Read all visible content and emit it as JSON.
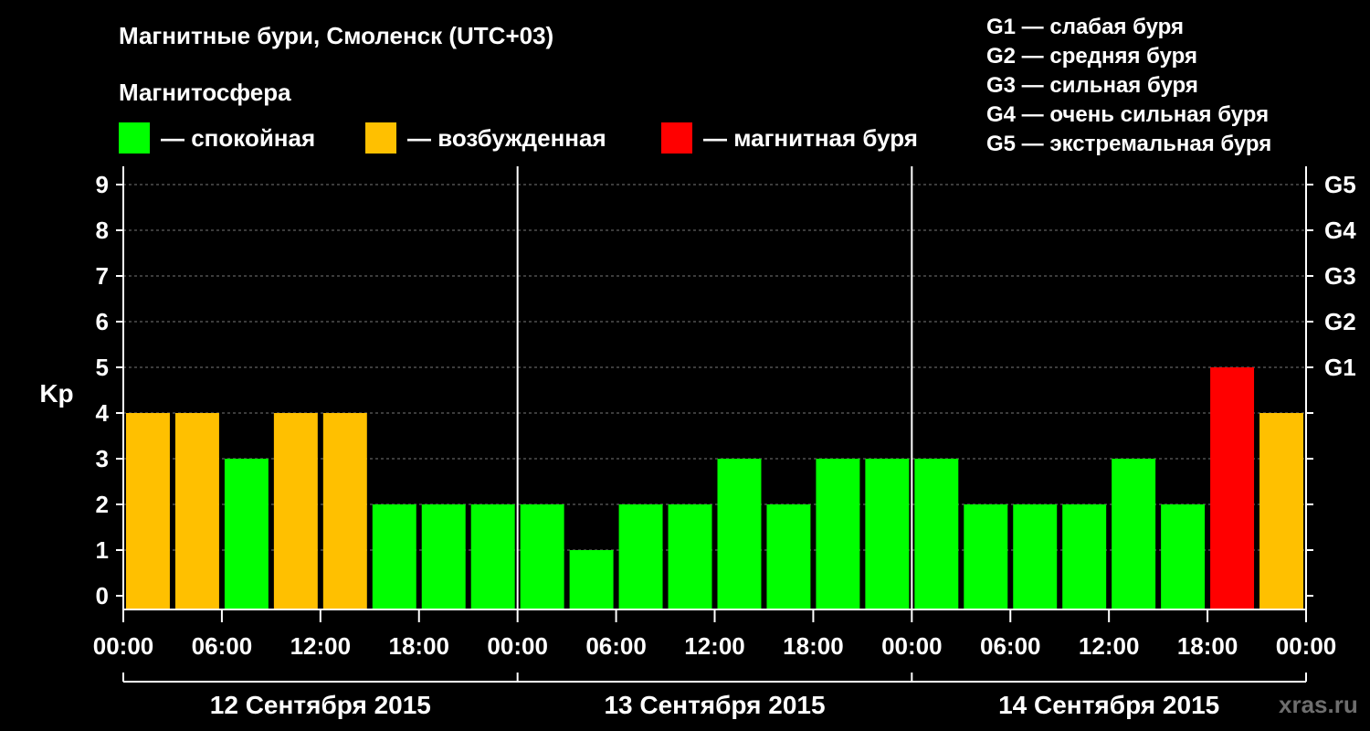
{
  "header": {
    "title": "Магнитные бури, Смоленск (UTC+03)",
    "subtitle": "Магнитосфера"
  },
  "legend": [
    {
      "color": "#00ff00",
      "label": "— спокойная"
    },
    {
      "color": "#ffc000",
      "label": "— возбужденная"
    },
    {
      "color": "#ff0000",
      "label": "— магнитная буря"
    }
  ],
  "g_legend": [
    "G1 — слабая буря",
    "G2 — средняя буря",
    "G3 — сильная буря",
    "G4 — очень сильная буря",
    "G5 — экстремальная буря"
  ],
  "watermark": "xras.ru",
  "chart_data": {
    "type": "bar",
    "ylabel": "Kp",
    "ylim": [
      0,
      9
    ],
    "y_ticks": [
      "0",
      "1",
      "2",
      "3",
      "4",
      "5",
      "6",
      "7",
      "8",
      "9"
    ],
    "right_ticks": [
      {
        "value": 5,
        "label": "G1"
      },
      {
        "value": 6,
        "label": "G2"
      },
      {
        "value": 7,
        "label": "G3"
      },
      {
        "value": 8,
        "label": "G4"
      },
      {
        "value": 9,
        "label": "G5"
      }
    ],
    "x_tick_labels": [
      "00:00",
      "06:00",
      "12:00",
      "18:00",
      "00:00",
      "06:00",
      "12:00",
      "18:00",
      "00:00",
      "06:00",
      "12:00",
      "18:00",
      "00:00"
    ],
    "days": [
      "12 Сентября 2015",
      "13 Сентября 2015",
      "14 Сентября 2015"
    ],
    "interval_hours": 3,
    "values": [
      4,
      4,
      3,
      4,
      4,
      2,
      2,
      2,
      2,
      1,
      2,
      2,
      3,
      2,
      3,
      3,
      3,
      2,
      2,
      2,
      3,
      2,
      5,
      4
    ],
    "grid": "dashed horizontal",
    "colors": {
      "quiet": "#00ff00",
      "excited": "#ffc000",
      "storm": "#ff0000"
    }
  }
}
